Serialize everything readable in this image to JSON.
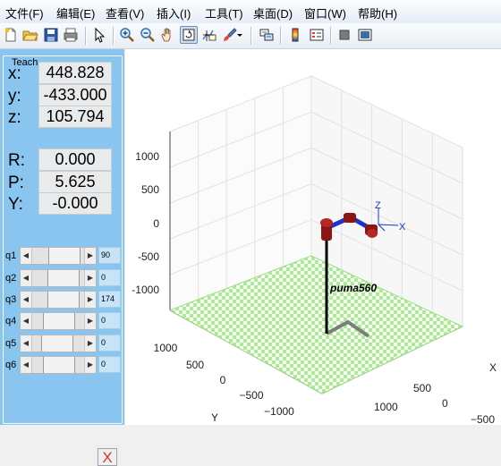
{
  "menu": [
    "文件(F)",
    "编辑(E)",
    "查看(V)",
    "插入(I)",
    "工具(T)",
    "桌面(D)",
    "窗口(W)",
    "帮助(H)"
  ],
  "toolbar": {
    "icons": [
      "new-figure-icon",
      "open-file-icon",
      "save-icon",
      "print-icon",
      "pointer-icon",
      "zoom-in-icon",
      "zoom-out-icon",
      "pan-hand-icon",
      "rotate-3d-icon",
      "data-cursor-icon",
      "brush-icon",
      "link-plot-icon",
      "colorbar-icon",
      "legend-icon",
      "hide-plot-tools-icon",
      "show-plot-tools-icon"
    ]
  },
  "teach": {
    "title": "Teach",
    "x_label": "x:",
    "x_value": "448.828",
    "y_label": "y:",
    "y_value": "-433.000",
    "z_label": "z:",
    "z_value": "105.794",
    "r_label": "R:",
    "r_value": "0.000",
    "p_label": "P:",
    "p_value": "5.625",
    "yaw_label": "Y:",
    "yaw_value": "-0.000",
    "joints": [
      {
        "label": "q1",
        "value": "90",
        "position": 0.52
      },
      {
        "label": "q2",
        "value": "0",
        "position": 0.5
      },
      {
        "label": "q3",
        "value": "174",
        "position": 0.5
      },
      {
        "label": "q4",
        "value": "0",
        "position": 0.35
      },
      {
        "label": "q5",
        "value": "0",
        "position": 0.3
      },
      {
        "label": "q6",
        "value": "0",
        "position": 0.35
      }
    ],
    "close_label": "X"
  },
  "plot": {
    "z_ticks": [
      "1000",
      "500",
      "0",
      "-500",
      "-1000"
    ],
    "y_ticks": [
      "1000",
      "500",
      "0",
      "−500",
      "−1000"
    ],
    "x_ticks": [
      "1000",
      "500",
      "0",
      "−500",
      "−1000"
    ],
    "y_axis_label": "Y",
    "x_axis_label": "X",
    "robot_name": "puma560",
    "frame_z": "Z",
    "frame_x": "X",
    "floor_color": "#a9ee8f"
  }
}
